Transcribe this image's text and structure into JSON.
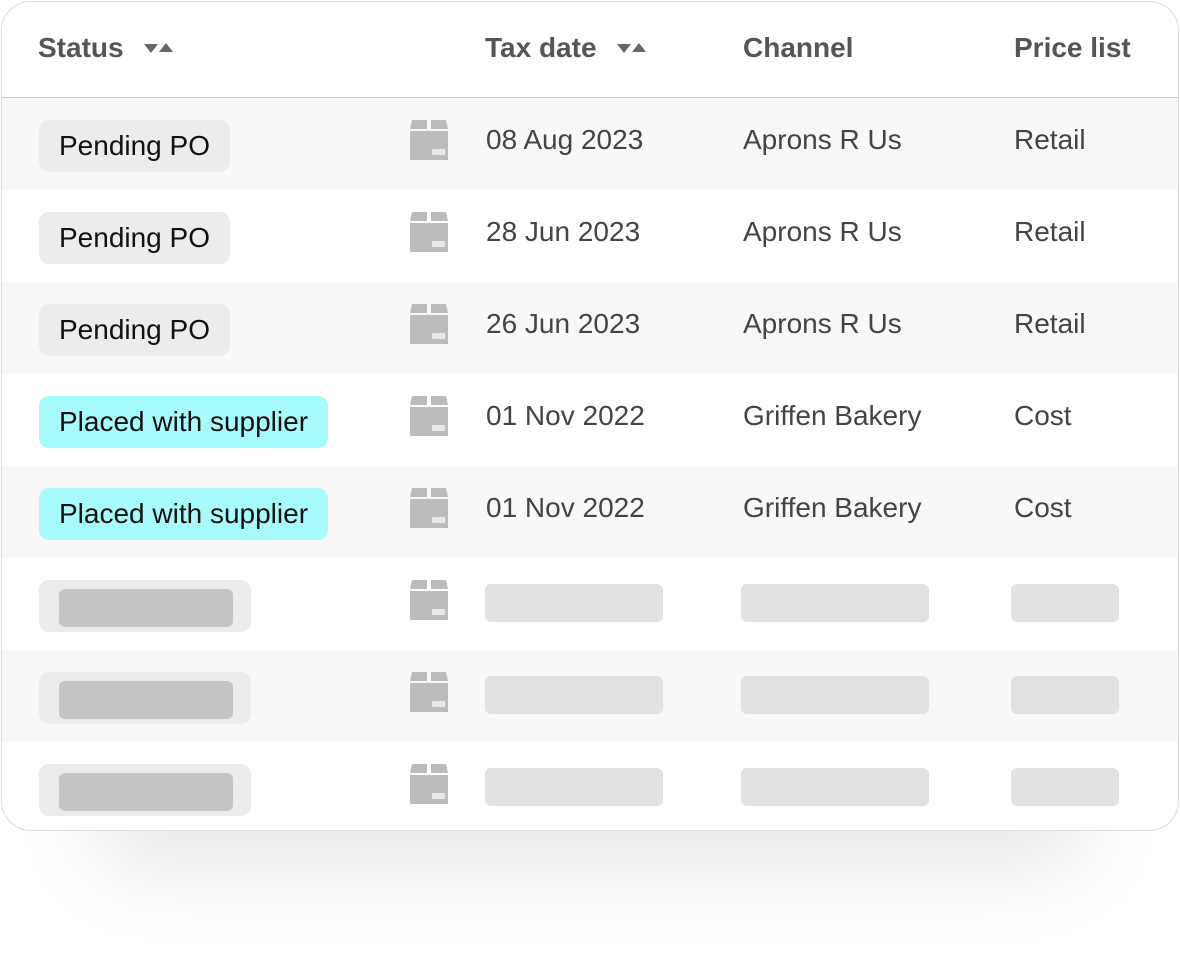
{
  "table": {
    "columns": [
      {
        "label": "Status",
        "sortable": true
      },
      {
        "label": "Tax date",
        "sortable": true
      },
      {
        "label": "Channel",
        "sortable": false
      },
      {
        "label": "Price list",
        "sortable": false
      }
    ],
    "rows": [
      {
        "status": "Pending PO",
        "status_type": "pending",
        "tax_date": "08 Aug 2023",
        "channel": "Aprons R Us",
        "price_list": "Retail"
      },
      {
        "status": "Pending PO",
        "status_type": "pending",
        "tax_date": "28 Jun 2023",
        "channel": "Aprons R Us",
        "price_list": "Retail"
      },
      {
        "status": "Pending PO",
        "status_type": "pending",
        "tax_date": "26 Jun 2023",
        "channel": "Aprons R Us",
        "price_list": "Retail"
      },
      {
        "status": "Placed with supplier",
        "status_type": "placed",
        "tax_date": "01 Nov 2022",
        "channel": "Griffen Bakery",
        "price_list": "Cost"
      },
      {
        "status": "Placed with supplier",
        "status_type": "placed",
        "tax_date": "01 Nov 2022",
        "channel": "Griffen Bakery",
        "price_list": "Cost"
      }
    ],
    "loading_rows": 3,
    "row_icon": "package-box-icon"
  },
  "colors": {
    "pending_badge": "#ececec",
    "placed_badge": "#a8fbfd",
    "header_text": "#555555",
    "cell_text": "#444444"
  }
}
